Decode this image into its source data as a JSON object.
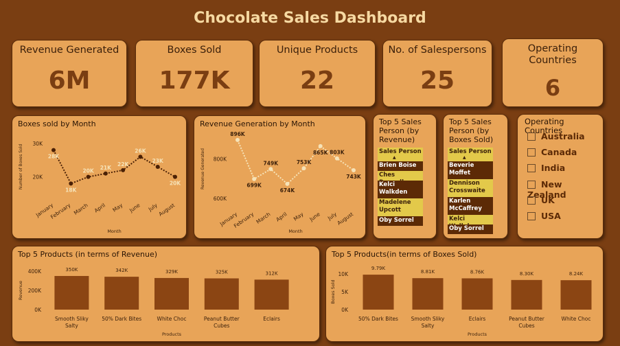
{
  "title": "Chocolate Sales Dashboard",
  "kpis": [
    {
      "label": "Revenue Generated",
      "value": "6M"
    },
    {
      "label": "Boxes Sold",
      "value": "177K"
    },
    {
      "label": "Unique Products",
      "value": "22"
    },
    {
      "label": "No. of Salespersons",
      "value": "25"
    },
    {
      "label": "Operating Countries",
      "value": "6"
    }
  ],
  "colors": {
    "background": "#7a3e12",
    "card": "#e8a458",
    "bar": "#8b4513",
    "line": "#5c2a06",
    "highlight": "#e3c94a"
  },
  "chart_data": [
    {
      "type": "line",
      "title": "Boxes sold by Month",
      "xlabel": "Month",
      "ylabel": "Number of Boxes Sold",
      "x": [
        "January",
        "February",
        "March",
        "April",
        "May",
        "June",
        "July",
        "August"
      ],
      "values": [
        28,
        18,
        20,
        21,
        22,
        26,
        23,
        20
      ],
      "data_labels": [
        "28K",
        "18K",
        "20K",
        "21K",
        "22K",
        "26K",
        "23K",
        "20K"
      ],
      "yticks": [
        "20K",
        "30K"
      ],
      "ylim": [
        15,
        31
      ]
    },
    {
      "type": "line",
      "title": "Revenue Generation by Month",
      "xlabel": "Month",
      "ylabel": "Revenue Generated",
      "x": [
        "January",
        "February",
        "March",
        "April",
        "May",
        "June",
        "July",
        "August"
      ],
      "values": [
        896,
        699,
        749,
        674,
        753,
        865,
        803,
        743
      ],
      "data_labels": [
        "896K",
        "699K",
        "749K",
        "674K",
        "753K",
        "865K",
        "803K",
        "743K"
      ],
      "yticks": [
        "600K",
        "800K"
      ],
      "ylim": [
        580,
        920
      ]
    },
    {
      "type": "bar",
      "title": "Top 5 Products (in terms of Revenue)",
      "xlabel": "Products",
      "ylabel": "Revenue",
      "categories": [
        "Smooth Sliky Salty",
        "50% Dark Bites",
        "White Choc",
        "Peanut Butter Cubes",
        "Eclairs"
      ],
      "values": [
        350,
        342,
        329,
        325,
        312
      ],
      "data_labels": [
        "350K",
        "342K",
        "329K",
        "325K",
        "312K"
      ],
      "yticks": [
        "0K",
        "200K",
        "400K"
      ],
      "ylim": [
        0,
        400
      ]
    },
    {
      "type": "bar",
      "title": "Top 5 Products(in terms of Boxes Sold)",
      "xlabel": "Products",
      "ylabel": "Boxes Sold",
      "categories": [
        "50% Dark Bites",
        "Smooth Sliky Salty",
        "Eclairs",
        "Peanut Butter Cubes",
        "White Choc"
      ],
      "values": [
        9.79,
        8.81,
        8.76,
        8.3,
        8.24
      ],
      "data_labels": [
        "9.79K",
        "8.81K",
        "8.76K",
        "8.30K",
        "8.24K"
      ],
      "yticks": [
        "0K",
        "5K",
        "10K"
      ],
      "ylim": [
        0,
        10
      ]
    }
  ],
  "top_sales_revenue": {
    "title": "Top 5 Sales Person (by Revenue)",
    "header": "Sales Person",
    "rows": [
      "Brien Boise",
      "Ches Bonnell",
      "Kelci Walkden",
      "Madelene Upcott",
      "Oby Sorrel"
    ]
  },
  "top_sales_boxes": {
    "title": "Top 5 Sales Person (by Boxes Sold)",
    "header": "Sales Person",
    "rows": [
      "Beverie Moffet",
      "Dennison Crosswaite",
      "Karlen McCaffrey",
      "Kelci Walkden",
      "Oby Sorrel"
    ]
  },
  "countries": {
    "title": "Operating Countries",
    "items": [
      "Australia",
      "Canada",
      "India",
      "New Zealand",
      "UK",
      "USA"
    ]
  }
}
